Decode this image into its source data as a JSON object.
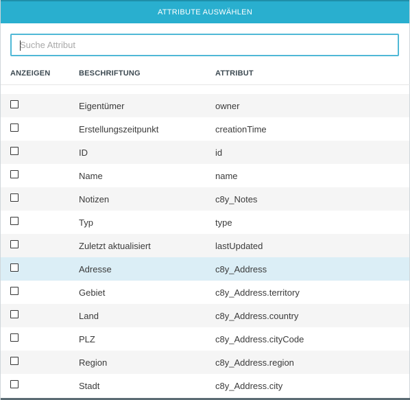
{
  "dialog": {
    "title": "ATTRIBUTE AUSWÄHLEN"
  },
  "search": {
    "placeholder": "Suche Attribut",
    "value": ""
  },
  "table": {
    "headers": {
      "show": "ANZEIGEN",
      "label": "BESCHRIFTUNG",
      "attribute": "ATTRIBUT"
    },
    "rows": [
      {
        "label": "Eigentümer",
        "attribute": "owner",
        "checked": false
      },
      {
        "label": "Erstellungszeitpunkt",
        "attribute": "creationTime",
        "checked": false
      },
      {
        "label": "ID",
        "attribute": "id",
        "checked": false
      },
      {
        "label": "Name",
        "attribute": "name",
        "checked": false
      },
      {
        "label": "Notizen",
        "attribute": "c8y_Notes",
        "checked": false
      },
      {
        "label": "Typ",
        "attribute": "type",
        "checked": false
      },
      {
        "label": "Zuletzt aktualisiert",
        "attribute": "lastUpdated",
        "checked": false
      },
      {
        "label": "Adresse",
        "attribute": "c8y_Address",
        "checked": false
      },
      {
        "label": "Gebiet",
        "attribute": "c8y_Address.territory",
        "checked": false
      },
      {
        "label": "Land",
        "attribute": "c8y_Address.country",
        "checked": false
      },
      {
        "label": "PLZ",
        "attribute": "c8y_Address.cityCode",
        "checked": false
      },
      {
        "label": "Region",
        "attribute": "c8y_Address.region",
        "checked": false
      },
      {
        "label": "Stadt",
        "attribute": "c8y_Address.city",
        "checked": false
      }
    ]
  },
  "colors": {
    "header_bg": "#29afcf",
    "search_border": "#4fb8d6",
    "row_highlight": "#dbeef6",
    "row_alt": "#f5f5f5"
  }
}
